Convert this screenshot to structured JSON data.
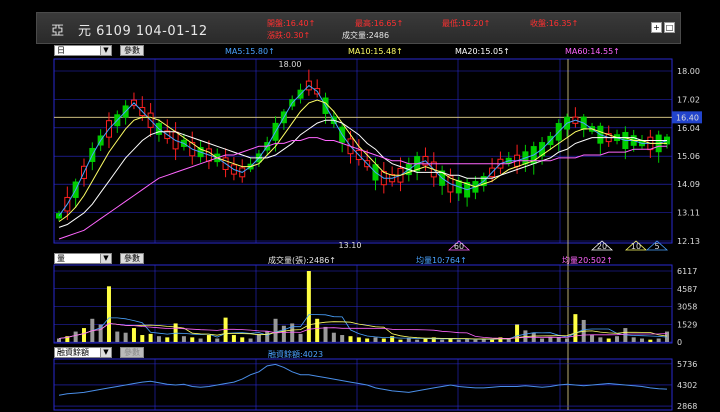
{
  "header": {
    "title": "亞　元 6109 104-01-12",
    "open": "開盤:16.40↑",
    "change": "漲跌:0.30↑",
    "high": "最高:16.65↑",
    "low": "最低:16.20↑",
    "close": "收盤:16.35↑",
    "volume": "成交量:2486"
  },
  "colors": {
    "up": "#ff2020",
    "down": "#00cc00",
    "ma5": "#4aa3ff",
    "ma10": "#ffff66",
    "ma20": "#ffffff",
    "ma60": "#ff66ff",
    "grid": "#2a2ad0"
  },
  "price_panel": {
    "period_select": "日",
    "param_button": "參數",
    "ma5": "MA5:15.80↑",
    "ma10": "MA10:15.48↑",
    "ma20": "MA20:15.05↑",
    "ma60": "MA60:14.55↑",
    "yaxis": [
      "18.00",
      "17.02",
      "16.04",
      "15.06",
      "14.09",
      "13.11",
      "12.13"
    ],
    "current_price": "16.40",
    "high_label": "18.00",
    "low_label": "13.10",
    "markers": [
      "60",
      "20",
      "10",
      "5"
    ]
  },
  "volume_panel": {
    "select": "量",
    "param_button": "參數",
    "volume_label": "成交量(張):2486↑",
    "avg10": "均量10:764↑",
    "avg20": "均量20:502↑",
    "yaxis": [
      "6117",
      "4587",
      "3058",
      "1529",
      "0"
    ]
  },
  "margin_panel": {
    "select": "融資餘額",
    "param_button": "參數",
    "label": "融資餘額:4023",
    "yaxis": [
      "5736",
      "4302",
      "2868"
    ]
  },
  "chart_data": [
    {
      "type": "line",
      "title": "",
      "xlabel": "",
      "ylabel": "",
      "ylim": [
        12.13,
        18.0
      ],
      "series": [
        {
          "name": "",
          "values": [
            13.0,
            13.4,
            13.9,
            14.5,
            15.1,
            15.6,
            16.0,
            16.3,
            16.6,
            16.9,
            16.6,
            16.3,
            16.0,
            15.8,
            15.6,
            15.5,
            15.3,
            15.2,
            15.1,
            15.0,
            14.8,
            14.6,
            14.5,
            14.7,
            15.0,
            15.4,
            15.9,
            16.4,
            16.9,
            17.2,
            17.5,
            17.3,
            16.8,
            16.3,
            15.8,
            15.4,
            15.1,
            14.8,
            14.5,
            14.3,
            14.3,
            14.4,
            14.6,
            14.8,
            14.9,
            14.6,
            14.3,
            14.1,
            14.0,
            13.9,
            14.0,
            14.2,
            14.5,
            14.8,
            14.9,
            14.9,
            15.0,
            15.1,
            15.3,
            15.6,
            15.9,
            16.2,
            16.3,
            16.2,
            16.0,
            15.8,
            15.7,
            15.7,
            15.6,
            15.6,
            15.5,
            15.5,
            15.5,
            15.6
          ]
        },
        {
          "name": "",
          "values": [
            12.8,
            13.0,
            13.3,
            13.7,
            14.2,
            14.7,
            15.2,
            15.6,
            16.0,
            16.3,
            16.4,
            16.4,
            16.3,
            16.1,
            15.9,
            15.7,
            15.5,
            15.3,
            15.2,
            15.0,
            14.9,
            14.8,
            14.7,
            14.7,
            14.8,
            15.1,
            15.4,
            15.8,
            16.2,
            16.6,
            16.9,
            17.0,
            16.9,
            16.6,
            16.2,
            15.8,
            15.4,
            15.1,
            14.8,
            14.5,
            14.4,
            14.4,
            14.5,
            14.6,
            14.7,
            14.6,
            14.5,
            14.3,
            14.2,
            14.1,
            14.0,
            14.1,
            14.2,
            14.4,
            14.6,
            14.7,
            14.8,
            14.9,
            15.1,
            15.3,
            15.5,
            15.7,
            15.9,
            16.0,
            16.0,
            15.9,
            15.8,
            15.7,
            15.7,
            15.6,
            15.6,
            15.5,
            15.5,
            15.5
          ]
        },
        {
          "name": "",
          "values": [
            12.6,
            12.7,
            12.9,
            13.1,
            13.4,
            13.8,
            14.2,
            14.6,
            15.0,
            15.3,
            15.6,
            15.8,
            15.9,
            15.9,
            15.9,
            15.8,
            15.7,
            15.6,
            15.5,
            15.4,
            15.3,
            15.2,
            15.1,
            15.0,
            15.0,
            15.0,
            15.1,
            15.3,
            15.5,
            15.8,
            16.0,
            16.2,
            16.3,
            16.3,
            16.2,
            16.0,
            15.8,
            15.5,
            15.3,
            15.0,
            14.8,
            14.7,
            14.6,
            14.5,
            14.5,
            14.5,
            14.5,
            14.4,
            14.4,
            14.3,
            14.3,
            14.3,
            14.3,
            14.4,
            14.5,
            14.6,
            14.7,
            14.8,
            14.9,
            15.0,
            15.2,
            15.3,
            15.5,
            15.6,
            15.7,
            15.7,
            15.7,
            15.7,
            15.7,
            15.7,
            15.6,
            15.6,
            15.6,
            15.6
          ]
        },
        {
          "name": "",
          "values": [
            12.2,
            12.3,
            12.4,
            12.5,
            12.7,
            12.9,
            13.1,
            13.3,
            13.5,
            13.7,
            13.9,
            14.1,
            14.3,
            14.4,
            14.5,
            14.6,
            14.7,
            14.8,
            14.9,
            15.0,
            15.1,
            15.1,
            15.2,
            15.3,
            15.4,
            15.4,
            15.5,
            15.5,
            15.6,
            15.6,
            15.7,
            15.7,
            15.6,
            15.6,
            15.5,
            15.4,
            15.3,
            15.2,
            15.1,
            15.0,
            14.9,
            14.9,
            14.8,
            14.8,
            14.8,
            14.8,
            14.8,
            14.8,
            14.8,
            14.8,
            14.8,
            14.8,
            14.8,
            14.8,
            14.8,
            14.9,
            14.9,
            14.9,
            14.9,
            14.9,
            15.0,
            15.0,
            15.0,
            15.1,
            15.1,
            15.1,
            15.2,
            15.2,
            15.2,
            15.3,
            15.3,
            15.3,
            15.4,
            15.4
          ]
        }
      ]
    },
    {
      "type": "bar",
      "title": "",
      "xlabel": "",
      "ylabel": "",
      "ylim": [
        0,
        6117
      ],
      "values": [
        300,
        500,
        900,
        1200,
        2000,
        1500,
        4800,
        900,
        800,
        1200,
        600,
        700,
        500,
        400,
        1600,
        500,
        400,
        300,
        600,
        300,
        2100,
        600,
        400,
        300,
        700,
        900,
        2000,
        1400,
        1600,
        700,
        6117,
        2000,
        1300,
        800,
        600,
        500,
        400,
        300,
        400,
        300,
        500,
        200,
        300,
        200,
        300,
        400,
        200,
        300,
        200,
        300,
        200,
        250,
        200,
        400,
        300,
        1500,
        1000,
        800,
        300,
        400,
        400,
        300,
        2400,
        1900,
        600,
        400,
        300,
        500,
        1200,
        400,
        300,
        200,
        300,
        900
      ]
    },
    {
      "type": "line",
      "title": "",
      "xlabel": "",
      "ylabel": "",
      "ylim": [
        2600,
        6000
      ],
      "values": [
        3600,
        3700,
        3750,
        3800,
        3900,
        4000,
        4100,
        4200,
        4300,
        4400,
        4500,
        4550,
        4450,
        4350,
        4300,
        4350,
        4200,
        4150,
        4200,
        4300,
        4400,
        4500,
        4700,
        5000,
        5200,
        5600,
        5700,
        5500,
        5200,
        5000,
        5000,
        4900,
        4800,
        4700,
        4600,
        4500,
        4400,
        4300,
        4100,
        4000,
        3900,
        3850,
        3800,
        3900,
        4000,
        4100,
        4200,
        4300,
        4200,
        4150,
        4100,
        4100,
        4150,
        4200,
        4200,
        4200,
        4250,
        4200,
        4150,
        4200,
        4300,
        4350,
        4300,
        4250,
        4300,
        4350,
        4400,
        4350,
        4300,
        4250,
        4200,
        4100,
        4050,
        4023
      ]
    }
  ]
}
